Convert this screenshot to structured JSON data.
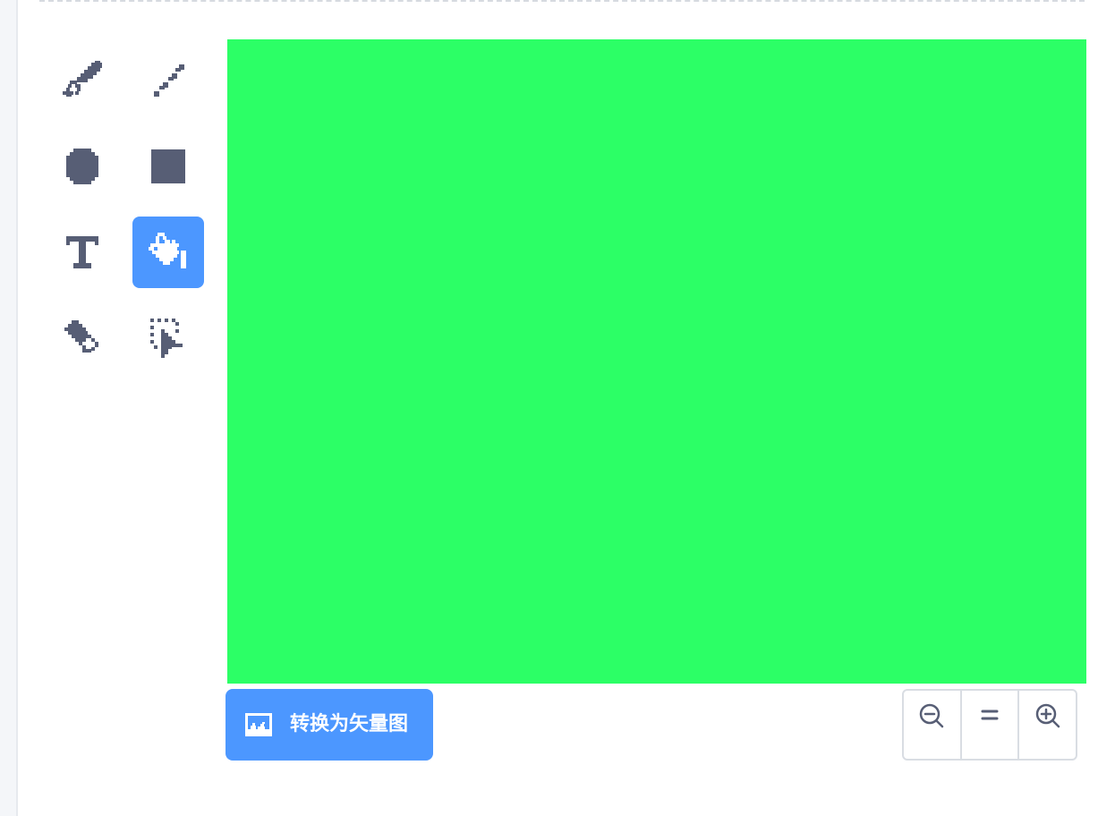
{
  "tools": [
    {
      "icon": "brush-icon",
      "active": false
    },
    {
      "icon": "line-icon",
      "active": false
    },
    {
      "icon": "circle-icon",
      "active": false
    },
    {
      "icon": "rectangle-icon",
      "active": false
    },
    {
      "icon": "text-icon",
      "active": false
    },
    {
      "icon": "fill-bucket-icon",
      "active": true
    },
    {
      "icon": "eraser-icon",
      "active": false
    },
    {
      "icon": "select-icon",
      "active": false
    }
  ],
  "canvas": {
    "fill_color": "#2cff66"
  },
  "convert": {
    "label": "转换为矢量图",
    "icon": "bitmap-image-icon"
  },
  "zoom": [
    {
      "icon": "zoom-out-icon"
    },
    {
      "icon": "zoom-reset-icon"
    },
    {
      "icon": "zoom-in-icon"
    }
  ],
  "colors": {
    "accent": "#4c97ff",
    "icon": "#575e75"
  }
}
